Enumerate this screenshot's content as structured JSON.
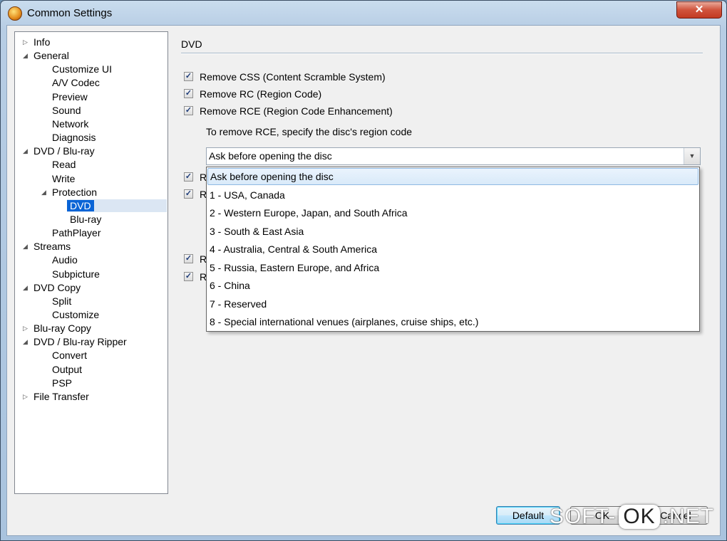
{
  "window": {
    "title": "Common Settings",
    "close_label": "✕"
  },
  "tree": [
    {
      "label": "Info",
      "level": 0,
      "expander": "▷"
    },
    {
      "label": "General",
      "level": 0,
      "expander": "◢"
    },
    {
      "label": "Customize UI",
      "level": 1,
      "expander": ""
    },
    {
      "label": "A/V Codec",
      "level": 1,
      "expander": ""
    },
    {
      "label": "Preview",
      "level": 1,
      "expander": ""
    },
    {
      "label": "Sound",
      "level": 1,
      "expander": ""
    },
    {
      "label": "Network",
      "level": 1,
      "expander": ""
    },
    {
      "label": "Diagnosis",
      "level": 1,
      "expander": ""
    },
    {
      "label": "DVD / Blu-ray",
      "level": 0,
      "expander": "◢"
    },
    {
      "label": "Read",
      "level": 1,
      "expander": ""
    },
    {
      "label": "Write",
      "level": 1,
      "expander": ""
    },
    {
      "label": "Protection",
      "level": 1,
      "expander": "◢"
    },
    {
      "label": "DVD",
      "level": 2,
      "expander": "",
      "selected": true
    },
    {
      "label": "Blu-ray",
      "level": 2,
      "expander": ""
    },
    {
      "label": "PathPlayer",
      "level": 1,
      "expander": ""
    },
    {
      "label": "Streams",
      "level": 0,
      "expander": "◢"
    },
    {
      "label": "Audio",
      "level": 1,
      "expander": ""
    },
    {
      "label": "Subpicture",
      "level": 1,
      "expander": ""
    },
    {
      "label": "DVD Copy",
      "level": 0,
      "expander": "◢"
    },
    {
      "label": "Split",
      "level": 1,
      "expander": ""
    },
    {
      "label": "Customize",
      "level": 1,
      "expander": ""
    },
    {
      "label": "Blu-ray Copy",
      "level": 0,
      "expander": "▷"
    },
    {
      "label": "DVD / Blu-ray Ripper",
      "level": 0,
      "expander": "◢"
    },
    {
      "label": "Convert",
      "level": 1,
      "expander": ""
    },
    {
      "label": "Output",
      "level": 1,
      "expander": ""
    },
    {
      "label": "PSP",
      "level": 1,
      "expander": ""
    },
    {
      "label": "File Transfer",
      "level": 0,
      "expander": "▷"
    }
  ],
  "panel": {
    "section_title": "DVD",
    "checkboxes": [
      {
        "label": "Remove CSS (Content Scramble System)",
        "checked": true
      },
      {
        "label": "Remove RC (Region Code)",
        "checked": true
      },
      {
        "label": "Remove RCE (Region Code Enhancement)",
        "checked": true
      }
    ],
    "hidden_checkboxes": [
      {
        "label": "R",
        "checked": true
      },
      {
        "label": "R",
        "checked": true
      },
      {
        "label": "R",
        "checked": true
      },
      {
        "label": "R",
        "checked": true
      }
    ],
    "rce_hint": "To remove RCE, specify the disc's region code",
    "region_combo": {
      "value": "Ask before opening the disc",
      "options": [
        "Ask before opening the disc",
        "1 - USA, Canada",
        "2 - Western Europe, Japan, and South Africa",
        "3 - South & East Asia",
        "4 - Australia, Central & South America",
        "5 - Russia, Eastern Europe, and Africa",
        "6 - China",
        "7 - Reserved",
        "8 - Special international venues (airplanes, cruise ships, etc.)"
      ]
    }
  },
  "buttons": {
    "default": "Default",
    "ok": "OK",
    "cancel": "Cancel"
  },
  "watermark": {
    "left": "SOFT-",
    "ok": "OK",
    "right": ".NET"
  }
}
